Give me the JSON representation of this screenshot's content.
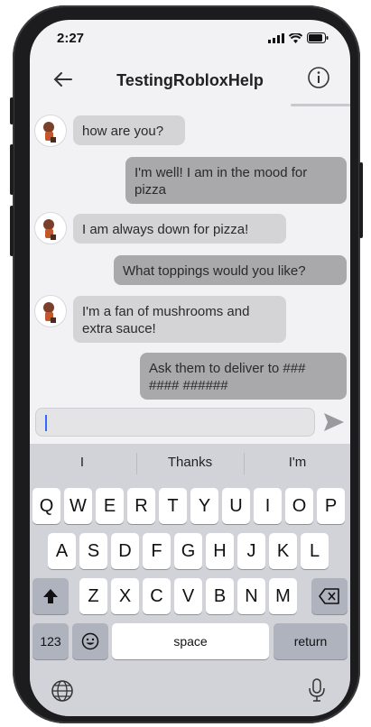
{
  "status": {
    "time": "2:27"
  },
  "header": {
    "title": "TestingRobloxHelp",
    "back_icon": "back-arrow-icon",
    "info_icon": "info-icon"
  },
  "messages": [
    {
      "from": "them",
      "text": "how are you?"
    },
    {
      "from": "me",
      "text": "I'm well! I am in the mood for pizza"
    },
    {
      "from": "them",
      "text": "I am always down for pizza!"
    },
    {
      "from": "me",
      "text": "What toppings would you like?"
    },
    {
      "from": "them",
      "text": "I'm a fan of mushrooms and extra sauce!"
    },
    {
      "from": "me",
      "text": "Ask them to deliver to ### #### ######"
    }
  ],
  "composer": {
    "value": "",
    "send_icon": "send-icon"
  },
  "keyboard": {
    "suggestions": [
      "I",
      "Thanks",
      "I'm"
    ],
    "row1": [
      "Q",
      "W",
      "E",
      "R",
      "T",
      "Y",
      "U",
      "I",
      "O",
      "P"
    ],
    "row2": [
      "A",
      "S",
      "D",
      "F",
      "G",
      "H",
      "J",
      "K",
      "L"
    ],
    "row3": [
      "Z",
      "X",
      "C",
      "V",
      "B",
      "N",
      "M"
    ],
    "numbers_key": "123",
    "space_key": "space",
    "return_key": "return"
  },
  "colors": {
    "incoming_bubble": "#d4d4d6",
    "outgoing_bubble": "#a9a9ac",
    "keyboard_bg": "#d1d3d9"
  }
}
